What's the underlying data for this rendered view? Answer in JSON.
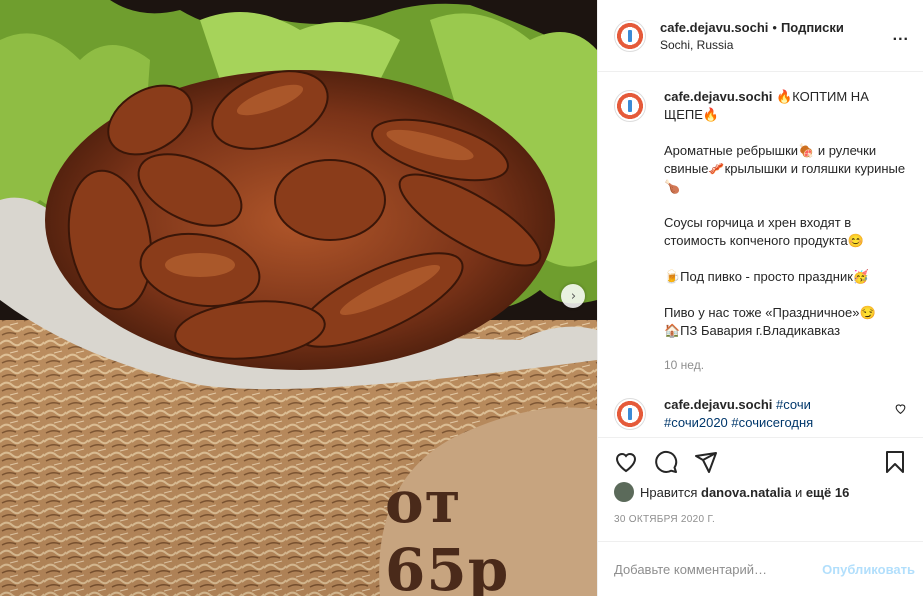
{
  "post": {
    "price_overlay": "от 65р"
  },
  "header": {
    "username": "cafe.dejavu.sochi",
    "separator": "•",
    "follow_label": "Подписки",
    "location": "Sochi, Russia",
    "more_label": "..."
  },
  "caption": {
    "username": "cafe.dejavu.sochi",
    "line1": "🔥КОПТИМ НА ЩЕПЕ🔥",
    "para2": "Ароматные ребрышки🍖 и рулечки свиные🥓крылышки и голяшки куриные🍗",
    "para3": "Соусы горчица и хрен входят в стоимость копченого продукта😊",
    "para4": "🍺Под пивко - просто праздник🥳",
    "para5a": "Пиво у нас тоже «Праздничное»😏",
    "para5b": "🏠ПЗ Бавария г.Владикавказ",
    "age": "10 нед."
  },
  "comment": {
    "username": "cafe.dejavu.sochi",
    "tag1": "#сочи",
    "tag2": "#сочи2020",
    "tag3": "#сочисегодня"
  },
  "likes": {
    "prefix": "Нравится",
    "user": "danova.natalia",
    "middle": "и",
    "others": "ещё 16"
  },
  "date": "30 октября 2020 г.",
  "add_comment": {
    "placeholder": "Добавьте комментарий…",
    "publish_label": "Опубликовать"
  },
  "icons": {
    "like": "heart-icon",
    "comment": "comment-icon",
    "share": "share-icon",
    "save": "bookmark-icon",
    "next": "chevron-right-icon"
  }
}
